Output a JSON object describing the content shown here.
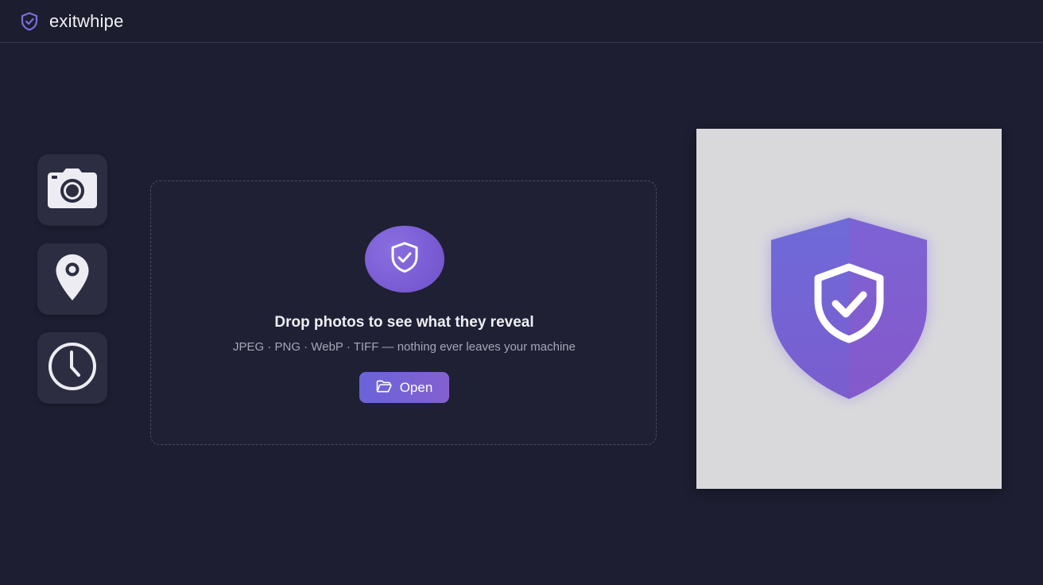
{
  "app": {
    "name": "exitwhipe",
    "accent": "#7a62d8"
  },
  "rail": {
    "items": [
      {
        "icon": "camera-icon"
      },
      {
        "icon": "location-pin-icon"
      },
      {
        "icon": "clock-icon"
      }
    ]
  },
  "dropzone": {
    "icon": "shield-check-icon",
    "title": "Drop photos to see what they reveal",
    "subtitle": "JPEG · PNG · WebP · TIFF — nothing ever leaves your machine",
    "open_label": "Open",
    "open_icon": "folder-open-icon"
  },
  "preview": {
    "icon": "shield-check-icon"
  }
}
